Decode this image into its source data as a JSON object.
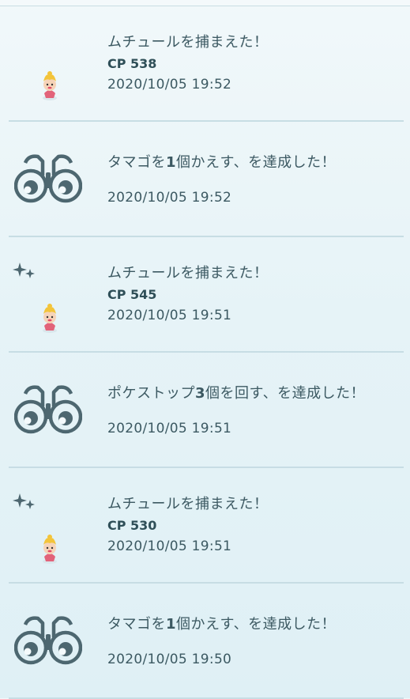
{
  "entries": [
    {
      "type": "catch",
      "title": "ムチュールを捕まえた！",
      "cp": "CP 538",
      "datetime": "2020/10/05 19:52",
      "shiny": false,
      "icon": "smoochum-icon"
    },
    {
      "type": "achievement",
      "title_prefix": "タマゴを",
      "title_bold": "1",
      "title_suffix": "個かえす、を達成した！",
      "datetime": "2020/10/05 19:52",
      "icon": "binoculars-icon"
    },
    {
      "type": "catch",
      "title": "ムチュールを捕まえた！",
      "cp": "CP 545",
      "datetime": "2020/10/05 19:51",
      "shiny": true,
      "icon": "smoochum-icon"
    },
    {
      "type": "achievement",
      "title_prefix": "ポケストップ",
      "title_bold": "3",
      "title_suffix": "個を回す、を達成した！",
      "datetime": "2020/10/05 19:51",
      "icon": "binoculars-icon"
    },
    {
      "type": "catch",
      "title": "ムチュールを捕まえた！",
      "cp": "CP 530",
      "datetime": "2020/10/05 19:51",
      "shiny": true,
      "icon": "smoochum-icon"
    },
    {
      "type": "achievement",
      "title_prefix": "タマゴを",
      "title_bold": "1",
      "title_suffix": "個かえす、を達成した！",
      "datetime": "2020/10/05 19:50",
      "icon": "binoculars-icon"
    }
  ],
  "colors": {
    "text": "#3c5962",
    "divider": "#c7dde4",
    "icon_stroke": "#4d6770"
  }
}
